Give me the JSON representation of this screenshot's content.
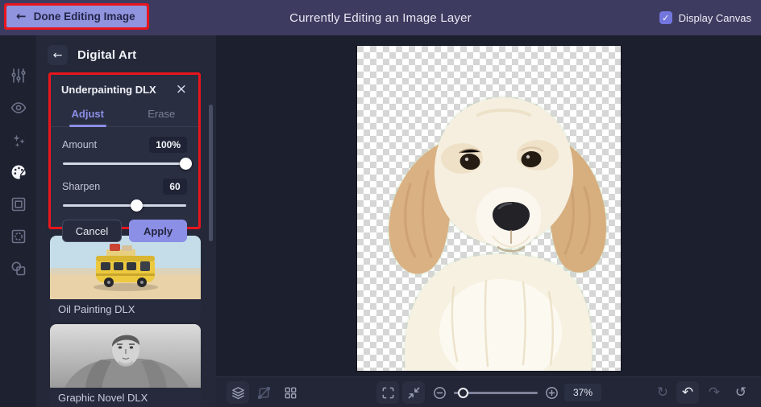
{
  "colors": {
    "accent": "#8b8fe6",
    "annotation_red": "#e8151d",
    "topbar_bg": "#3e3b60",
    "panel_bg": "#242838",
    "canvas_bg": "#1c1f2d"
  },
  "topbar": {
    "done_button": {
      "icon": "←",
      "label": "Done Editing Image"
    },
    "title": "Currently Editing an Image Layer",
    "display_canvas": {
      "label": "Display Canvas",
      "checked": true,
      "check_icon": "✓"
    }
  },
  "tool_strip": {
    "items": [
      {
        "name": "adjust-sliders-icon",
        "active": false
      },
      {
        "name": "touchup-eye-icon",
        "active": false
      },
      {
        "name": "effects-sparkles-icon",
        "active": false
      },
      {
        "name": "artsy-palette-icon",
        "active": true
      },
      {
        "name": "frames-icon",
        "active": false
      },
      {
        "name": "textures-icon",
        "active": false
      },
      {
        "name": "overlays-icon",
        "active": false
      }
    ]
  },
  "panel": {
    "back_icon": "←",
    "title": "Digital Art",
    "tool_card": {
      "title": "Underpainting DLX",
      "close_icon": "×",
      "tabs": [
        {
          "label": "Adjust",
          "active": true
        },
        {
          "label": "Erase",
          "active": false
        }
      ],
      "sliders": [
        {
          "label": "Amount",
          "display_value": "100%",
          "percent": 100
        },
        {
          "label": "Sharpen",
          "display_value": "60",
          "percent": 60
        }
      ],
      "cancel_label": "Cancel",
      "apply_label": "Apply"
    },
    "effects_list": [
      {
        "label": "Oil Painting DLX"
      },
      {
        "label": "Graphic Novel DLX"
      }
    ]
  },
  "canvas": {
    "content_description": "Cream golden retriever puppy cut out on a transparent checkerboard background"
  },
  "bottom_toolbar": {
    "zoom_value": "37%",
    "zoom_slider_percent": 12,
    "icons": {
      "undo": "↶",
      "redo": "↷",
      "refresh": "↻",
      "history": "↺"
    }
  }
}
